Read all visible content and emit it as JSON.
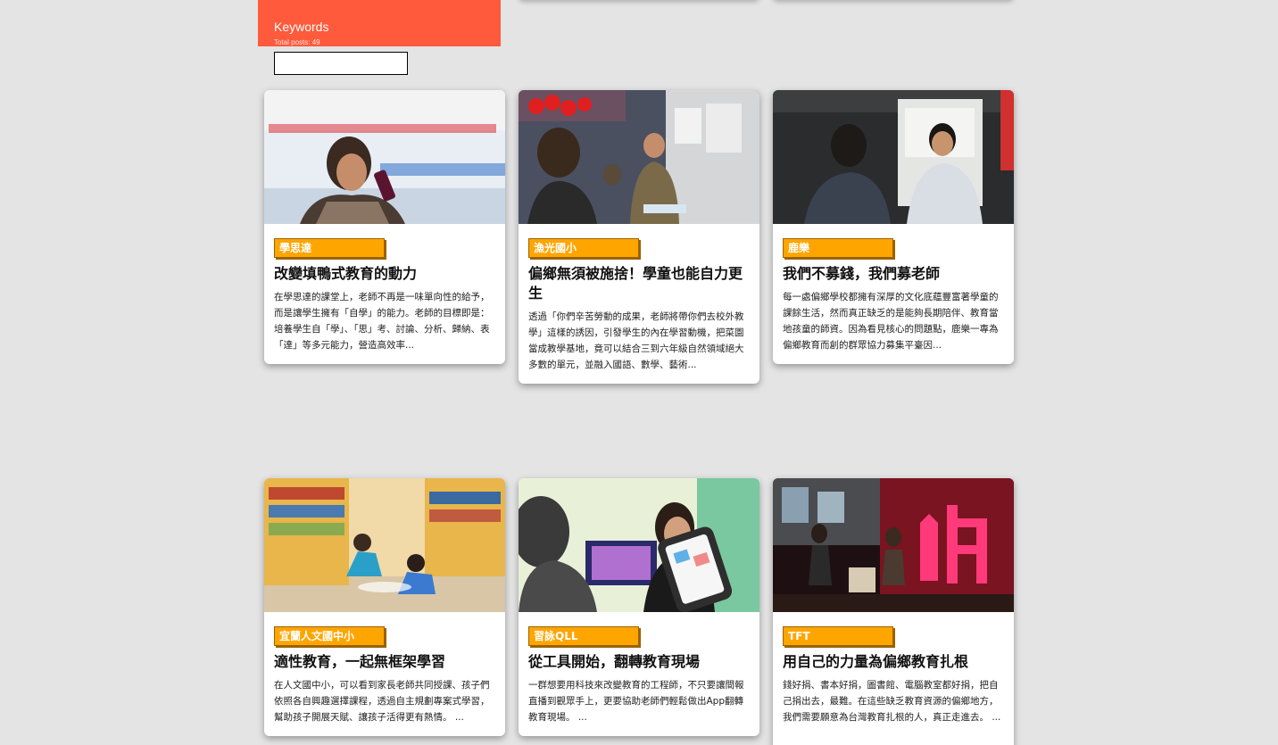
{
  "keywords": {
    "title": "Keywords",
    "total": "Total posts: 49",
    "input_value": ""
  },
  "posts": [
    {
      "tag": "學思達",
      "title": "改變填鴨式教育的動力",
      "desc": "在學思達的課堂上，老師不再是一味單向性的給予，而是讓學生擁有「自學」的能力。老師的目標即是：培養學生自「學」、「思」考、討論、分析、歸納、表「達」等多元能力，營造高效率..."
    },
    {
      "tag": "漁光國小",
      "title": "偏鄉無須被施捨！學童也能自力更生",
      "desc": "透過「你們辛苦勞動的成果，老師將帶你們去校外教學」這樣的誘因，引發學生的內在學習動機，把菜園當成教學基地，竟可以結合三到六年級自然領域絕大多數的單元，並融入國語、數學、藝術..."
    },
    {
      "tag": "鹿樂",
      "title": "我們不募錢，我們募老師",
      "desc": "每一處偏鄉學校都擁有深厚的文化底蘊豐富著學童的課餘生活，然而真正缺乏的是能夠長期陪伴、教育當地孩童的師資。因為看見核心的問題點，鹿樂一專為偏鄉教育而創的群眾協力募集平臺因..."
    },
    {
      "tag": "宜蘭人文國中小",
      "title": "適性教育，一起無框架學習",
      "desc": "在人文國中小，可以看到家長老師共同授課、孩子們依照各自興趣選擇課程，透過自主規劃專案式學習，幫助孩子開展天賦、讓孩子活得更有熱情。 ..."
    },
    {
      "tag": "習詠QLL",
      "title": "從工具開始，翻轉教育現場",
      "desc": "一群想要用科技來改變教育的工程師，不只要讓間報直播到觀眾手上，更要協助老師們輕鬆做出App翻轉教育現場。 ..."
    },
    {
      "tag": "TFT",
      "title": "用自己的力量為偏鄉教育扎根",
      "desc": "錢好捐、書本好捐，圖書館、電腦教室都好捐，把自己捐出去，最難。在這些缺乏教育資源的偏鄉地方，我們需要願意為台灣教育扎根的人，真正走進去。 ..."
    }
  ]
}
